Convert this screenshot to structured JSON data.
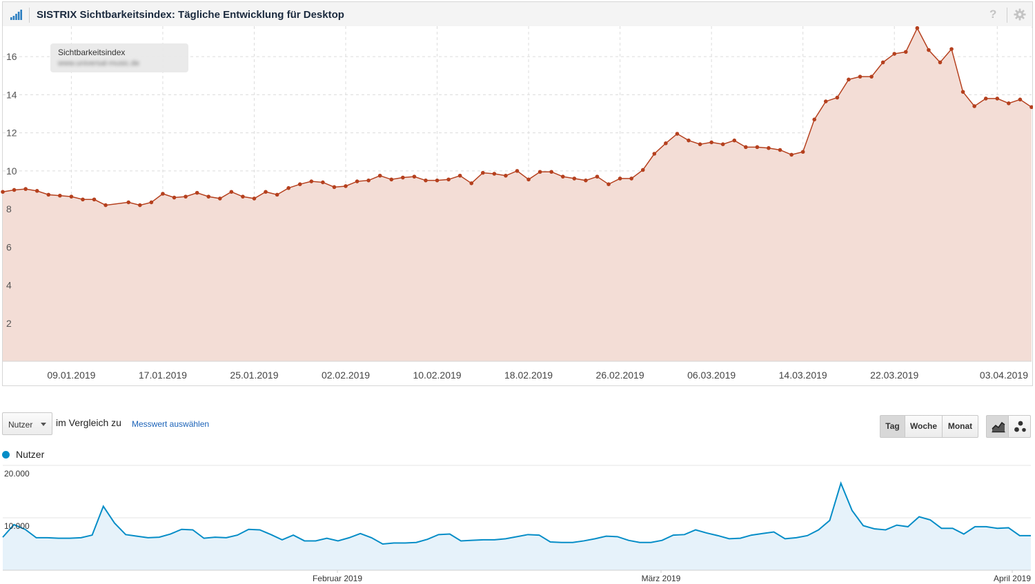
{
  "header": {
    "title": "SISTRIX Sichtbarkeitsindex: Tägliche Entwicklung für Desktop",
    "help_label": "?",
    "icon_bars": "signal-bars-icon",
    "icon_settings": "gear-icon"
  },
  "legend_box": {
    "label": "Sichtbarkeitsindex",
    "domain": "www.universal-music.de"
  },
  "controls": {
    "metric_select": "Nutzer",
    "compare_text": "im Vergleich zu",
    "compare_link": "Messwert auswählen",
    "btn_day": "Tag",
    "btn_week": "Woche",
    "btn_month": "Monat"
  },
  "colors": {
    "sistrix_line": "#b5401e",
    "sistrix_fill": "#f3ddd6",
    "ga_line": "#058dc7",
    "ga_fill": "#e6f2fa"
  },
  "chart_data": [
    {
      "type": "area",
      "title": "SISTRIX Sichtbarkeitsindex: Tägliche Entwicklung für Desktop",
      "series_name": "Sichtbarkeitsindex",
      "x_ticks": [
        "09.01.2019",
        "17.01.2019",
        "25.01.2019",
        "02.02.2019",
        "10.02.2019",
        "18.02.2019",
        "26.02.2019",
        "06.03.2019",
        "14.03.2019",
        "22.03.2019",
        "03.04.2019"
      ],
      "x_tick_index": [
        6,
        14,
        22,
        30,
        38,
        46,
        54,
        62,
        70,
        78,
        87
      ],
      "y_ticks": [
        2,
        4,
        6,
        8,
        10,
        12,
        14,
        16
      ],
      "ylim": [
        0,
        17.6
      ],
      "grid": true,
      "x_range_days": [
        0,
        88
      ],
      "points": [
        [
          0,
          8.9
        ],
        [
          1,
          9.0
        ],
        [
          2,
          9.05
        ],
        [
          3,
          8.95
        ],
        [
          4,
          8.75
        ],
        [
          5,
          8.7
        ],
        [
          6,
          8.65
        ],
        [
          7,
          8.5
        ],
        [
          8,
          8.5
        ],
        [
          9,
          8.2
        ],
        [
          11,
          8.35
        ],
        [
          12,
          8.2
        ],
        [
          13,
          8.35
        ],
        [
          14,
          8.8
        ],
        [
          15,
          8.6
        ],
        [
          16,
          8.65
        ],
        [
          17,
          8.85
        ],
        [
          18,
          8.65
        ],
        [
          19,
          8.55
        ],
        [
          20,
          8.9
        ],
        [
          21,
          8.65
        ],
        [
          22,
          8.55
        ],
        [
          23,
          8.9
        ],
        [
          24,
          8.75
        ],
        [
          25,
          9.1
        ],
        [
          26,
          9.3
        ],
        [
          27,
          9.45
        ],
        [
          28,
          9.4
        ],
        [
          29,
          9.15
        ],
        [
          30,
          9.2
        ],
        [
          31,
          9.45
        ],
        [
          32,
          9.5
        ],
        [
          33,
          9.75
        ],
        [
          34,
          9.55
        ],
        [
          35,
          9.65
        ],
        [
          36,
          9.7
        ],
        [
          37,
          9.5
        ],
        [
          38,
          9.5
        ],
        [
          39,
          9.55
        ],
        [
          40,
          9.75
        ],
        [
          41,
          9.35
        ],
        [
          42,
          9.9
        ],
        [
          43,
          9.85
        ],
        [
          44,
          9.75
        ],
        [
          45,
          10.0
        ],
        [
          46,
          9.55
        ],
        [
          47,
          9.95
        ],
        [
          48,
          9.95
        ],
        [
          49,
          9.7
        ],
        [
          50,
          9.6
        ],
        [
          51,
          9.5
        ],
        [
          52,
          9.7
        ],
        [
          53,
          9.3
        ],
        [
          54,
          9.6
        ],
        [
          55,
          9.6
        ],
        [
          56,
          10.05
        ],
        [
          57,
          10.9
        ],
        [
          58,
          11.45
        ],
        [
          59,
          11.95
        ],
        [
          60,
          11.6
        ],
        [
          61,
          11.4
        ],
        [
          62,
          11.5
        ],
        [
          63,
          11.4
        ],
        [
          64,
          11.6
        ],
        [
          65,
          11.25
        ],
        [
          66,
          11.25
        ],
        [
          67,
          11.2
        ],
        [
          68,
          11.1
        ],
        [
          69,
          10.85
        ],
        [
          70,
          11.0
        ],
        [
          71,
          12.7
        ],
        [
          72,
          13.65
        ],
        [
          73,
          13.85
        ],
        [
          74,
          14.8
        ],
        [
          75,
          14.95
        ],
        [
          76,
          14.95
        ],
        [
          77,
          15.7
        ],
        [
          78,
          16.15
        ],
        [
          79,
          16.25
        ],
        [
          80,
          17.5
        ],
        [
          81,
          16.35
        ],
        [
          82,
          15.7
        ],
        [
          83,
          16.4
        ],
        [
          84,
          14.15
        ],
        [
          85,
          13.4
        ],
        [
          86,
          13.8
        ],
        [
          87,
          13.8
        ],
        [
          88,
          13.55
        ],
        [
          89,
          13.75
        ],
        [
          90,
          13.35
        ]
      ]
    },
    {
      "type": "area",
      "series_name": "Nutzer",
      "y_ticks_labels": [
        "10.000",
        "20.000"
      ],
      "y_ticks": [
        10000,
        20000
      ],
      "ylim": [
        0,
        20000
      ],
      "x_ticks": [
        "Februar 2019",
        "März 2019",
        "April 2019"
      ],
      "x_tick_index": [
        31,
        59,
        90
      ],
      "values": [
        6300,
        8700,
        7800,
        6200,
        6200,
        6100,
        6100,
        6200,
        6700,
        12200,
        9000,
        6800,
        6500,
        6200,
        6300,
        6900,
        7800,
        7700,
        6100,
        6300,
        6200,
        6700,
        7800,
        7700,
        6800,
        5800,
        6700,
        5600,
        5600,
        6100,
        5600,
        6200,
        7000,
        6200,
        5000,
        5200,
        5200,
        5300,
        5900,
        6800,
        6900,
        5600,
        5700,
        5800,
        5800,
        6000,
        6400,
        6800,
        6700,
        5400,
        5300,
        5300,
        5600,
        6000,
        6500,
        6400,
        5700,
        5300,
        5300,
        5700,
        6700,
        6800,
        7700,
        7100,
        6600,
        6000,
        6100,
        6700,
        7000,
        7300,
        6000,
        6200,
        6600,
        7700,
        9500,
        16600,
        11400,
        8500,
        7900,
        7700,
        8600,
        8300,
        10200,
        9600,
        8000,
        8000,
        6900,
        8300,
        8300,
        8000,
        8100,
        6600,
        6600
      ]
    }
  ]
}
